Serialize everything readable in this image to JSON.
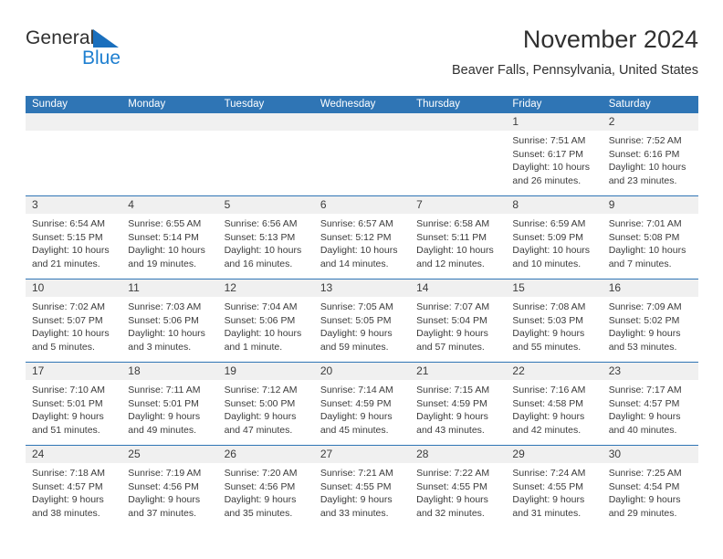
{
  "brand": {
    "line1": "General",
    "line2": "Blue",
    "mark_icon": "blue-triangle-flag-icon",
    "accent_color": "#1e7fd0"
  },
  "header": {
    "title": "November 2024",
    "subtitle": "Beaver Falls, Pennsylvania, United States"
  },
  "calendar": {
    "header_bg": "#2f75b5",
    "daynum_bg": "#f0f0f0",
    "weekdays": [
      "Sunday",
      "Monday",
      "Tuesday",
      "Wednesday",
      "Thursday",
      "Friday",
      "Saturday"
    ],
    "weeks": [
      [
        {
          "day": "",
          "sunrise": "",
          "sunset": "",
          "daylight": ""
        },
        {
          "day": "",
          "sunrise": "",
          "sunset": "",
          "daylight": ""
        },
        {
          "day": "",
          "sunrise": "",
          "sunset": "",
          "daylight": ""
        },
        {
          "day": "",
          "sunrise": "",
          "sunset": "",
          "daylight": ""
        },
        {
          "day": "",
          "sunrise": "",
          "sunset": "",
          "daylight": ""
        },
        {
          "day": "1",
          "sunrise": "Sunrise: 7:51 AM",
          "sunset": "Sunset: 6:17 PM",
          "daylight": "Daylight: 10 hours and 26 minutes."
        },
        {
          "day": "2",
          "sunrise": "Sunrise: 7:52 AM",
          "sunset": "Sunset: 6:16 PM",
          "daylight": "Daylight: 10 hours and 23 minutes."
        }
      ],
      [
        {
          "day": "3",
          "sunrise": "Sunrise: 6:54 AM",
          "sunset": "Sunset: 5:15 PM",
          "daylight": "Daylight: 10 hours and 21 minutes."
        },
        {
          "day": "4",
          "sunrise": "Sunrise: 6:55 AM",
          "sunset": "Sunset: 5:14 PM",
          "daylight": "Daylight: 10 hours and 19 minutes."
        },
        {
          "day": "5",
          "sunrise": "Sunrise: 6:56 AM",
          "sunset": "Sunset: 5:13 PM",
          "daylight": "Daylight: 10 hours and 16 minutes."
        },
        {
          "day": "6",
          "sunrise": "Sunrise: 6:57 AM",
          "sunset": "Sunset: 5:12 PM",
          "daylight": "Daylight: 10 hours and 14 minutes."
        },
        {
          "day": "7",
          "sunrise": "Sunrise: 6:58 AM",
          "sunset": "Sunset: 5:11 PM",
          "daylight": "Daylight: 10 hours and 12 minutes."
        },
        {
          "day": "8",
          "sunrise": "Sunrise: 6:59 AM",
          "sunset": "Sunset: 5:09 PM",
          "daylight": "Daylight: 10 hours and 10 minutes."
        },
        {
          "day": "9",
          "sunrise": "Sunrise: 7:01 AM",
          "sunset": "Sunset: 5:08 PM",
          "daylight": "Daylight: 10 hours and 7 minutes."
        }
      ],
      [
        {
          "day": "10",
          "sunrise": "Sunrise: 7:02 AM",
          "sunset": "Sunset: 5:07 PM",
          "daylight": "Daylight: 10 hours and 5 minutes."
        },
        {
          "day": "11",
          "sunrise": "Sunrise: 7:03 AM",
          "sunset": "Sunset: 5:06 PM",
          "daylight": "Daylight: 10 hours and 3 minutes."
        },
        {
          "day": "12",
          "sunrise": "Sunrise: 7:04 AM",
          "sunset": "Sunset: 5:06 PM",
          "daylight": "Daylight: 10 hours and 1 minute."
        },
        {
          "day": "13",
          "sunrise": "Sunrise: 7:05 AM",
          "sunset": "Sunset: 5:05 PM",
          "daylight": "Daylight: 9 hours and 59 minutes."
        },
        {
          "day": "14",
          "sunrise": "Sunrise: 7:07 AM",
          "sunset": "Sunset: 5:04 PM",
          "daylight": "Daylight: 9 hours and 57 minutes."
        },
        {
          "day": "15",
          "sunrise": "Sunrise: 7:08 AM",
          "sunset": "Sunset: 5:03 PM",
          "daylight": "Daylight: 9 hours and 55 minutes."
        },
        {
          "day": "16",
          "sunrise": "Sunrise: 7:09 AM",
          "sunset": "Sunset: 5:02 PM",
          "daylight": "Daylight: 9 hours and 53 minutes."
        }
      ],
      [
        {
          "day": "17",
          "sunrise": "Sunrise: 7:10 AM",
          "sunset": "Sunset: 5:01 PM",
          "daylight": "Daylight: 9 hours and 51 minutes."
        },
        {
          "day": "18",
          "sunrise": "Sunrise: 7:11 AM",
          "sunset": "Sunset: 5:01 PM",
          "daylight": "Daylight: 9 hours and 49 minutes."
        },
        {
          "day": "19",
          "sunrise": "Sunrise: 7:12 AM",
          "sunset": "Sunset: 5:00 PM",
          "daylight": "Daylight: 9 hours and 47 minutes."
        },
        {
          "day": "20",
          "sunrise": "Sunrise: 7:14 AM",
          "sunset": "Sunset: 4:59 PM",
          "daylight": "Daylight: 9 hours and 45 minutes."
        },
        {
          "day": "21",
          "sunrise": "Sunrise: 7:15 AM",
          "sunset": "Sunset: 4:59 PM",
          "daylight": "Daylight: 9 hours and 43 minutes."
        },
        {
          "day": "22",
          "sunrise": "Sunrise: 7:16 AM",
          "sunset": "Sunset: 4:58 PM",
          "daylight": "Daylight: 9 hours and 42 minutes."
        },
        {
          "day": "23",
          "sunrise": "Sunrise: 7:17 AM",
          "sunset": "Sunset: 4:57 PM",
          "daylight": "Daylight: 9 hours and 40 minutes."
        }
      ],
      [
        {
          "day": "24",
          "sunrise": "Sunrise: 7:18 AM",
          "sunset": "Sunset: 4:57 PM",
          "daylight": "Daylight: 9 hours and 38 minutes."
        },
        {
          "day": "25",
          "sunrise": "Sunrise: 7:19 AM",
          "sunset": "Sunset: 4:56 PM",
          "daylight": "Daylight: 9 hours and 37 minutes."
        },
        {
          "day": "26",
          "sunrise": "Sunrise: 7:20 AM",
          "sunset": "Sunset: 4:56 PM",
          "daylight": "Daylight: 9 hours and 35 minutes."
        },
        {
          "day": "27",
          "sunrise": "Sunrise: 7:21 AM",
          "sunset": "Sunset: 4:55 PM",
          "daylight": "Daylight: 9 hours and 33 minutes."
        },
        {
          "day": "28",
          "sunrise": "Sunrise: 7:22 AM",
          "sunset": "Sunset: 4:55 PM",
          "daylight": "Daylight: 9 hours and 32 minutes."
        },
        {
          "day": "29",
          "sunrise": "Sunrise: 7:24 AM",
          "sunset": "Sunset: 4:55 PM",
          "daylight": "Daylight: 9 hours and 31 minutes."
        },
        {
          "day": "30",
          "sunrise": "Sunrise: 7:25 AM",
          "sunset": "Sunset: 4:54 PM",
          "daylight": "Daylight: 9 hours and 29 minutes."
        }
      ]
    ]
  }
}
